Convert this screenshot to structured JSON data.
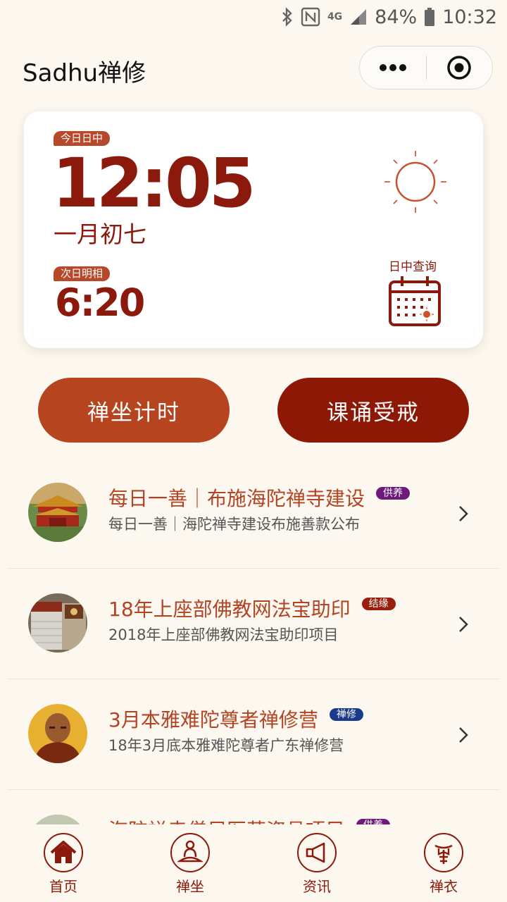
{
  "status_bar": {
    "battery": "84%",
    "time": "10:32",
    "network": "4G"
  },
  "header": {
    "title": "Sadhu禅修"
  },
  "card": {
    "today_tag": "今日日中",
    "today_time": "12:05",
    "lunar_date": "一月初七",
    "next_tag": "次日明相",
    "next_time": "6:20",
    "query_label": "日中查询"
  },
  "buttons": {
    "meditate": "禅坐计时",
    "chant": "课诵受戒"
  },
  "list": [
    {
      "title": "每日一善｜布施海陀禅寺建设",
      "badge": "供养",
      "badge_color": "#6e1a7a",
      "subtitle": "每日一善｜海陀禅寺建设布施善款公布"
    },
    {
      "title": "18年上座部佛教网法宝助印",
      "badge": "结缘",
      "badge_color": "#9a1e0c",
      "subtitle": "2018年上座部佛教网法宝助印项目"
    },
    {
      "title": "3月本雅难陀尊者禅修营",
      "badge": "禅修",
      "badge_color": "#1a3a8c",
      "subtitle": "18年3月底本雅难陀尊者广东禅修营"
    },
    {
      "title": "海陀禅寺僧尼医药资具项目",
      "badge": "供养",
      "badge_color": "#6e1a7a",
      "subtitle": ""
    }
  ],
  "tabs": [
    {
      "label": "首页",
      "icon": "home-icon"
    },
    {
      "label": "禅坐",
      "icon": "meditator-icon"
    },
    {
      "label": "资讯",
      "icon": "megaphone-icon"
    },
    {
      "label": "禅衣",
      "icon": "robe-icon"
    }
  ],
  "colors": {
    "accent": "#8b1a0c",
    "button_primary": "#b5441f",
    "button_secondary": "#8c1805",
    "background": "#fcf8f0"
  }
}
